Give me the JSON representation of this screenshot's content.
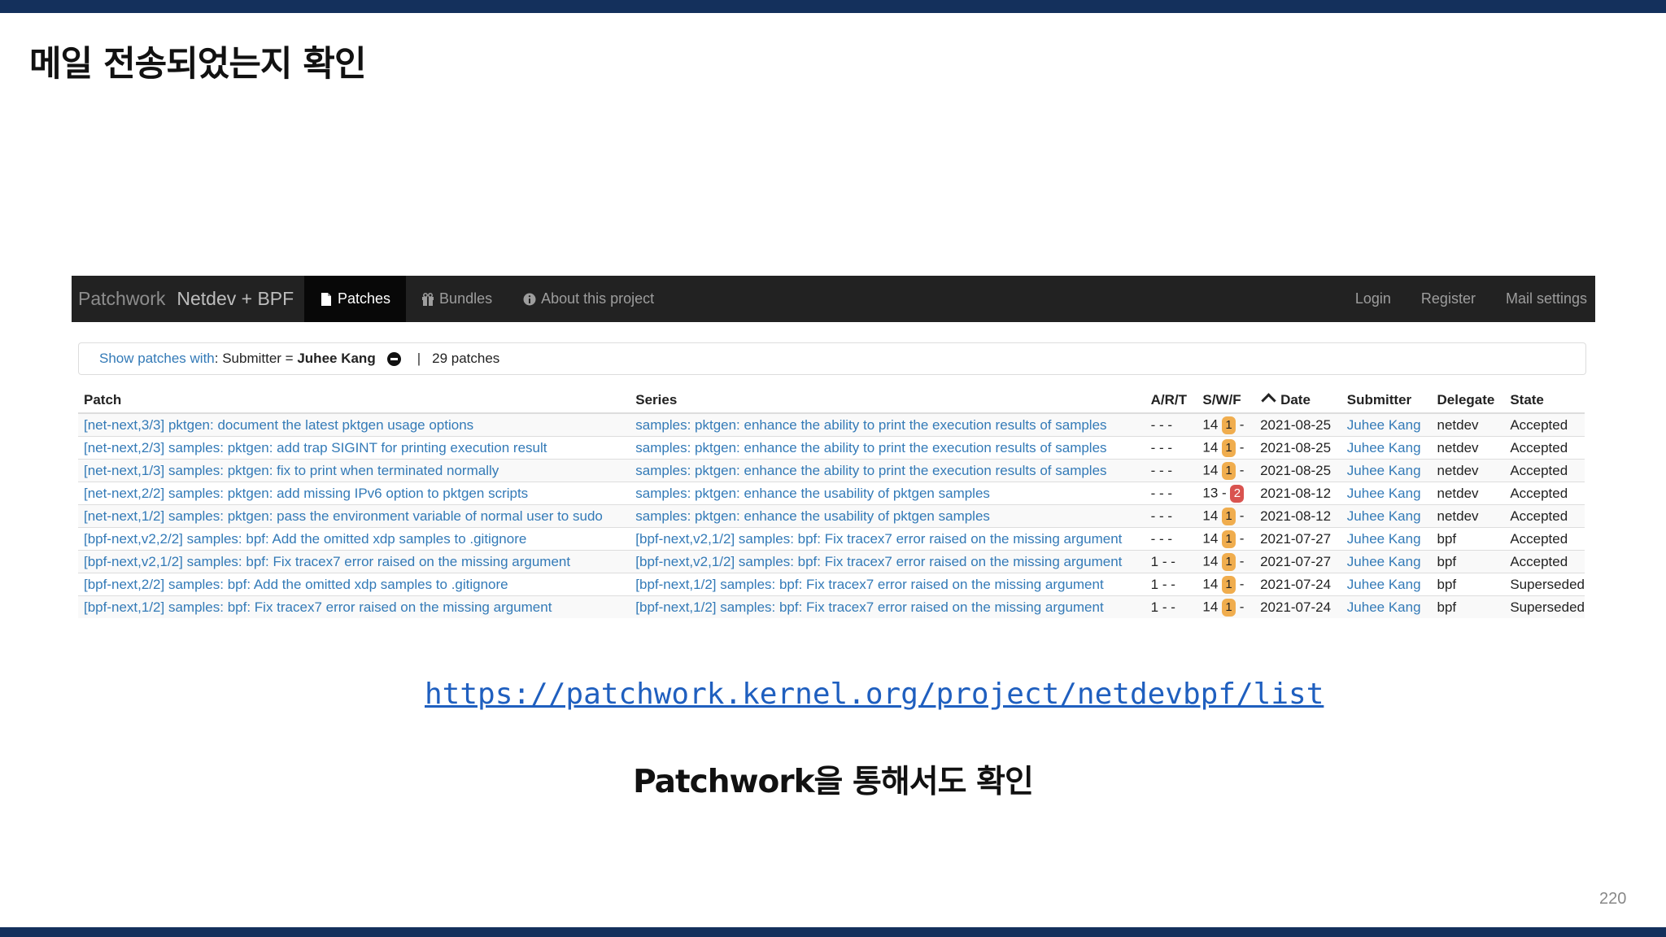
{
  "slide": {
    "title": "메일 전송되었는지 확인",
    "url": "https://patchwork.kernel.org/project/netdevbpf/list",
    "subtitle": "Patchwork을 통해서도 확인",
    "page_number": "220"
  },
  "navbar": {
    "brand": "Patchwork",
    "project": "Netdev + BPF",
    "items": [
      {
        "label": "Patches",
        "icon": "file-icon",
        "active": true
      },
      {
        "label": "Bundles",
        "icon": "gift-icon",
        "active": false
      },
      {
        "label": "About this project",
        "icon": "info-icon",
        "active": false
      }
    ],
    "right_items": [
      {
        "label": "Login"
      },
      {
        "label": "Register"
      },
      {
        "label": "Mail settings"
      }
    ]
  },
  "filter": {
    "show_label": "Show patches with",
    "colon": ":",
    "field": " Submitter = ",
    "value": "Juhee Kang",
    "separator": "|",
    "count": "29 patches"
  },
  "table": {
    "headers": [
      "Patch",
      "Series",
      "A/R/T",
      "S/W/F",
      "Date",
      "Submitter",
      "Delegate",
      "State"
    ],
    "rows": [
      {
        "patch": "[net-next,3/3] pktgen: document the latest pktgen usage options",
        "series": "samples: pktgen: enhance the ability to print the execution results of samples",
        "art": "- - -",
        "s": "14",
        "w": "1",
        "f": "-",
        "w_status": "warn",
        "date": "2021-08-25",
        "submitter": "Juhee Kang",
        "delegate": "netdev",
        "state": "Accepted"
      },
      {
        "patch": "[net-next,2/3] samples: pktgen: add trap SIGINT for printing execution result",
        "series": "samples: pktgen: enhance the ability to print the execution results of samples",
        "art": "- - -",
        "s": "14",
        "w": "1",
        "f": "-",
        "w_status": "warn",
        "date": "2021-08-25",
        "submitter": "Juhee Kang",
        "delegate": "netdev",
        "state": "Accepted"
      },
      {
        "patch": "[net-next,1/3] samples: pktgen: fix to print when terminated normally",
        "series": "samples: pktgen: enhance the ability to print the execution results of samples",
        "art": "- - -",
        "s": "14",
        "w": "1",
        "f": "-",
        "w_status": "warn",
        "date": "2021-08-25",
        "submitter": "Juhee Kang",
        "delegate": "netdev",
        "state": "Accepted"
      },
      {
        "patch": "[net-next,2/2] samples: pktgen: add missing IPv6 option to pktgen scripts",
        "series": "samples: pktgen: enhance the usability of pktgen samples",
        "art": "- - -",
        "s": "13",
        "w": "-",
        "f": "2",
        "w_status": "fail",
        "date": "2021-08-12",
        "submitter": "Juhee Kang",
        "delegate": "netdev",
        "state": "Accepted"
      },
      {
        "patch": "[net-next,1/2] samples: pktgen: pass the environment variable of normal user to sudo",
        "series": "samples: pktgen: enhance the usability of pktgen samples",
        "art": "- - -",
        "s": "14",
        "w": "1",
        "f": "-",
        "w_status": "warn",
        "date": "2021-08-12",
        "submitter": "Juhee Kang",
        "delegate": "netdev",
        "state": "Accepted"
      },
      {
        "patch": "[bpf-next,v2,2/2] samples: bpf: Add the omitted xdp samples to .gitignore",
        "series": "[bpf-next,v2,1/2] samples: bpf: Fix tracex7 error raised on the missing argument",
        "art": "- - -",
        "s": "14",
        "w": "1",
        "f": "-",
        "w_status": "warn",
        "date": "2021-07-27",
        "submitter": "Juhee Kang",
        "delegate": "bpf",
        "state": "Accepted"
      },
      {
        "patch": "[bpf-next,v2,1/2] samples: bpf: Fix tracex7 error raised on the missing argument",
        "series": "[bpf-next,v2,1/2] samples: bpf: Fix tracex7 error raised on the missing argument",
        "art": "1 - -",
        "s": "14",
        "w": "1",
        "f": "-",
        "w_status": "warn",
        "date": "2021-07-27",
        "submitter": "Juhee Kang",
        "delegate": "bpf",
        "state": "Accepted"
      },
      {
        "patch": "[bpf-next,2/2] samples: bpf: Add the omitted xdp samples to .gitignore",
        "series": "[bpf-next,1/2] samples: bpf: Fix tracex7 error raised on the missing argument",
        "art": "1 - -",
        "s": "14",
        "w": "1",
        "f": "-",
        "w_status": "warn",
        "date": "2021-07-24",
        "submitter": "Juhee Kang",
        "delegate": "bpf",
        "state": "Superseded"
      },
      {
        "patch": "[bpf-next,1/2] samples: bpf: Fix tracex7 error raised on the missing argument",
        "series": "[bpf-next,1/2] samples: bpf: Fix tracex7 error raised on the missing argument",
        "art": "1 - -",
        "s": "14",
        "w": "1",
        "f": "-",
        "w_status": "warn",
        "date": "2021-07-24",
        "submitter": "Juhee Kang",
        "delegate": "bpf",
        "state": "Superseded"
      }
    ]
  },
  "colors": {
    "slide_bar": "#14305c",
    "navbar_bg": "#222222",
    "link": "#337ab7",
    "warning_badge": "#f0ad4e",
    "fail_badge": "#d9534f"
  }
}
